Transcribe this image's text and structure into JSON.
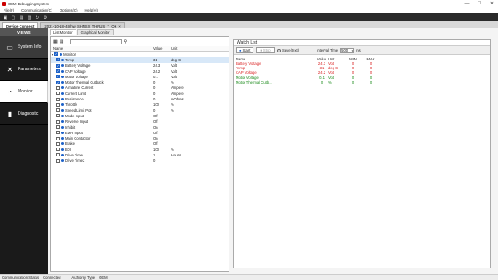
{
  "window": {
    "title": "OEM Debugging System",
    "minimize": "—",
    "maximize": "☐",
    "close": "✕"
  },
  "menu": [
    "File(F)",
    "Communication(C)",
    "Options(O)",
    "Help(H)"
  ],
  "tabs": [
    "Device Connect",
    "2021-10-18-48rhw_SHNSX_THRUS_T_OK"
  ],
  "sidebar": {
    "header": "VIEWS",
    "items": [
      {
        "label": "System Info",
        "icon": "monitor-icon"
      },
      {
        "label": "Parameters",
        "icon": "tools-icon"
      },
      {
        "label": "Monitor",
        "icon": "gauge-icon"
      },
      {
        "label": "Diagnostic",
        "icon": "wrench-icon"
      }
    ]
  },
  "subtabs": [
    "List Monitor",
    "Graphical Monitor"
  ],
  "tree": {
    "columns": {
      "name": "Name",
      "value": "Value",
      "unit": "Unit"
    },
    "root": "Monitor",
    "rows": [
      {
        "name": "Temp",
        "value": "31",
        "unit": "deg C",
        "checked": true
      },
      {
        "name": "Battery Voltage",
        "value": "24.3",
        "unit": "Volt",
        "checked": true
      },
      {
        "name": "CAP Voltage",
        "value": "24.2",
        "unit": "Volt",
        "checked": true
      },
      {
        "name": "Motor Voltage",
        "value": "0.1",
        "unit": "Volt",
        "checked": true
      },
      {
        "name": "Motor Thermal Cutback",
        "value": "0",
        "unit": "%",
        "checked": true
      },
      {
        "name": "Armature Current",
        "value": "0",
        "unit": "Ampere",
        "checked": false
      },
      {
        "name": "Current Limit",
        "value": "0",
        "unit": "Ampere",
        "checked": false
      },
      {
        "name": "Resistance",
        "value": "0",
        "unit": "mOhms",
        "checked": false
      },
      {
        "name": "Throttle",
        "value": "100",
        "unit": "%",
        "checked": false
      },
      {
        "name": "Speed Limit Pot",
        "value": "0",
        "unit": "%",
        "checked": false
      },
      {
        "name": "Mode Input",
        "value": "Off",
        "unit": "",
        "checked": false
      },
      {
        "name": "Reverse Input",
        "value": "Off",
        "unit": "",
        "checked": false
      },
      {
        "name": "Inhibit",
        "value": "On",
        "unit": "",
        "checked": false
      },
      {
        "name": "EMR Input",
        "value": "Off",
        "unit": "",
        "checked": false
      },
      {
        "name": "Main Contactor",
        "value": "On",
        "unit": "",
        "checked": false
      },
      {
        "name": "Brake",
        "value": "Off",
        "unit": "",
        "checked": false
      },
      {
        "name": "BDI",
        "value": "100",
        "unit": "%",
        "checked": false
      },
      {
        "name": "Drive Time",
        "value": "1",
        "unit": "Hours",
        "checked": false
      },
      {
        "name": "Drive Time2",
        "value": "0",
        "unit": "",
        "checked": false
      }
    ]
  },
  "watch": {
    "title": "Watch List",
    "start": "Start",
    "stop": "Stop",
    "save": "Save(text)",
    "interval_label": "Interval Time",
    "interval_value": "500",
    "interval_unit": "ms",
    "columns": {
      "name": "Name",
      "value": "Value",
      "unit": "Unit",
      "min": "MIN",
      "max": "MAX"
    },
    "rows": [
      {
        "name": "Battery Voltage",
        "value": "24.3",
        "unit": "Volt",
        "min": "0",
        "max": "0",
        "color": "#d81b1b"
      },
      {
        "name": "Temp",
        "value": "31",
        "unit": "deg C",
        "min": "0",
        "max": "0",
        "color": "#d81b1b"
      },
      {
        "name": "CAP Voltage",
        "value": "24.2",
        "unit": "Volt",
        "min": "0",
        "max": "0",
        "color": "#d81b1b"
      },
      {
        "name": "Motor Voltage",
        "value": "0.1",
        "unit": "Volt",
        "min": "0",
        "max": "0",
        "color": "#1a8a1a"
      },
      {
        "name": "Motor Thermal Cutb...",
        "value": "0",
        "unit": "%",
        "min": "0",
        "max": "0",
        "color": "#1a8a1a"
      }
    ]
  },
  "status": {
    "comm_label": "Communication Status",
    "comm_value": "Connected",
    "auth_label": "Authority Type",
    "auth_value": "OEM"
  }
}
